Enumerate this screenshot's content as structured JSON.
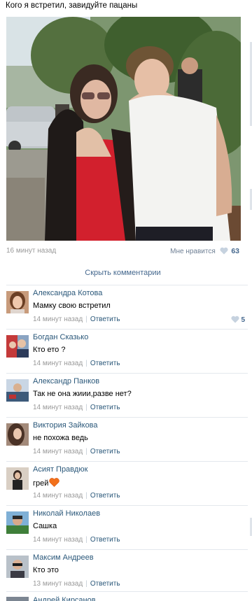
{
  "post": {
    "title": "Кого я встретил, завидуйте пацаны",
    "time": "16 минут назад",
    "like_label": "Мне нравится",
    "like_count": "63",
    "hide_comments": "Скрыть комментарии"
  },
  "colors": {
    "link": "#2b587a",
    "meta": "#999999",
    "like": "#45688e",
    "divider": "#e4e8ed"
  },
  "comments": [
    {
      "author": "Александра Котова",
      "text": "Мамку свою встретил",
      "time": "14 минут назад",
      "reply": "Ответить",
      "likes": "5"
    },
    {
      "author": "Богдан Сказько",
      "text": "Кто ето ?",
      "time": "14 минут назад",
      "reply": "Ответить"
    },
    {
      "author": "Александр Панков",
      "text": "Так не она жиии,разве нет?",
      "time": "14 минут назад",
      "reply": "Ответить"
    },
    {
      "author": "Виктория Зайкова",
      "text": "не похожа ведь",
      "time": "14 минут назад",
      "reply": "Ответить"
    },
    {
      "author": "Асият Правдюк",
      "text": "грей",
      "time": "14 минут назад",
      "reply": "Ответить",
      "emoji": "heart-emoji"
    },
    {
      "author": "Николай Николаев",
      "text": "Сашка",
      "time": "14 минут назад",
      "reply": "Ответить"
    },
    {
      "author": "Максим Андреев",
      "text": "Кто это",
      "time": "13 минут назад",
      "reply": "Ответить"
    }
  ],
  "last_comment": {
    "author": "Андрей Кирсанов"
  }
}
